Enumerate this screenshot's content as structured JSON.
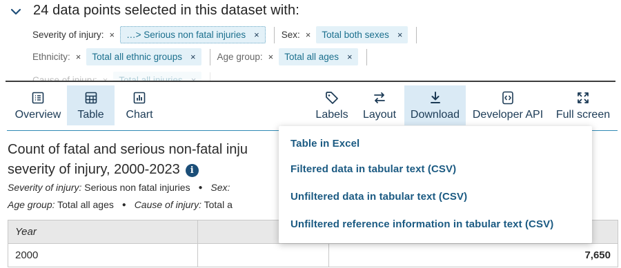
{
  "summary": {
    "title": "24 data points selected in this dataset with:",
    "filters": [
      {
        "label": "Severity of injury:",
        "value": "…> Serious non fatal injuries"
      },
      {
        "label": "Sex:",
        "value": "Total both sexes"
      },
      {
        "label": "Ethnicity:",
        "value": "Total all ethnic groups"
      },
      {
        "label": "Age group:",
        "value": "Total all ages"
      },
      {
        "label": "Cause of injury:",
        "value": "Total all injuries"
      }
    ],
    "remove_glyph": "×"
  },
  "toolbar": {
    "left": [
      {
        "label": "Overview",
        "icon": "list-icon"
      },
      {
        "label": "Table",
        "icon": "table-icon"
      },
      {
        "label": "Chart",
        "icon": "bar-chart-icon"
      }
    ],
    "right": [
      {
        "label": "Labels",
        "icon": "tag-icon"
      },
      {
        "label": "Layout",
        "icon": "swap-arrows-icon"
      },
      {
        "label": "Download",
        "icon": "download-icon"
      },
      {
        "label": "Developer API",
        "icon": "code-icon"
      },
      {
        "label": "Full screen",
        "icon": "expand-icon"
      }
    ],
    "active": [
      "Table",
      "Download"
    ]
  },
  "content": {
    "title_line1": "Count of fatal and serious non-fatal inju",
    "title_line2": "severity of injury, 2000-2023",
    "info_glyph": "i",
    "meta1_label1": "Severity of injury:",
    "meta1_value1": "Serious non fatal injuries",
    "meta1_label2": "Sex:",
    "meta2_label1": "Age group:",
    "meta2_value1": "Total all ages",
    "meta2_label2": "Cause of injury:",
    "meta2_value2": "Total a",
    "bullet": "●"
  },
  "table": {
    "header": "Year",
    "rows": [
      {
        "year": "2000",
        "value": "7,650"
      }
    ]
  },
  "download_menu": {
    "items": [
      "Table in Excel",
      "Filtered data in tabular text (CSV)",
      "Unfiltered data in tabular text (CSV)",
      "Unfiltered reference information in tabular text (CSV)"
    ]
  },
  "colors": {
    "accent": "#1b5a82",
    "chip_bg": "#e3f1f8",
    "active_bg": "#daeaf5"
  }
}
